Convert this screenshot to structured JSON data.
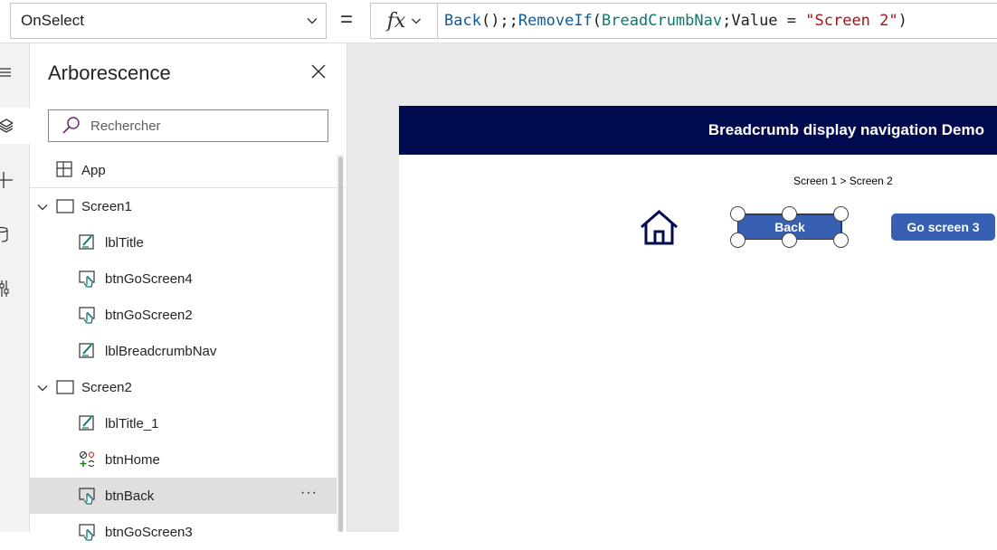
{
  "formula_bar": {
    "property": "OnSelect",
    "equals": "=",
    "fx_label": "fx",
    "formula_tokens": [
      {
        "text": "Back",
        "kind": "fn"
      },
      {
        "text": "();;",
        "kind": "op"
      },
      {
        "text": "RemoveIf",
        "kind": "fn"
      },
      {
        "text": "(",
        "kind": "op"
      },
      {
        "text": "BreadCrumbNav",
        "kind": "ref"
      },
      {
        "text": ";",
        "kind": "op"
      },
      {
        "text": "Value ",
        "kind": "plain"
      },
      {
        "text": "= ",
        "kind": "op"
      },
      {
        "text": "\"Screen 2\"",
        "kind": "str"
      },
      {
        "text": ")",
        "kind": "op"
      }
    ]
  },
  "rail": {
    "items": [
      {
        "icon": "hamburger-icon"
      },
      {
        "icon": "layers-icon",
        "active": true
      },
      {
        "icon": "plus-icon"
      },
      {
        "icon": "database-icon"
      },
      {
        "icon": "tools-icon"
      }
    ]
  },
  "tree": {
    "title": "Arborescence",
    "search_placeholder": "Rechercher",
    "app_label": "App",
    "nodes": [
      {
        "label": "Screen1",
        "kind": "screen",
        "expanded": true
      },
      {
        "label": "lblTitle",
        "kind": "label"
      },
      {
        "label": "btnGoScreen4",
        "kind": "button"
      },
      {
        "label": "btnGoScreen2",
        "kind": "button"
      },
      {
        "label": "lblBreadcrumbNav",
        "kind": "label"
      },
      {
        "label": "Screen2",
        "kind": "screen",
        "expanded": true
      },
      {
        "label": "lblTitle_1",
        "kind": "label"
      },
      {
        "label": "btnHome",
        "kind": "icon"
      },
      {
        "label": "btnBack",
        "kind": "button",
        "selected": true
      },
      {
        "label": "btnGoScreen3",
        "kind": "button"
      }
    ],
    "more_label": "···"
  },
  "canvas": {
    "header_title": "Breadcrumb display navigation Demo",
    "breadcrumb": "Screen 1 > Screen 2",
    "back_label": "Back",
    "go_screen3_label": "Go screen 3"
  },
  "colors": {
    "header_bg": "#000b4f",
    "button_bg": "#3860b2",
    "canvas_bg": "#e9e9e9",
    "tree_selected": "#e1dfdd"
  }
}
